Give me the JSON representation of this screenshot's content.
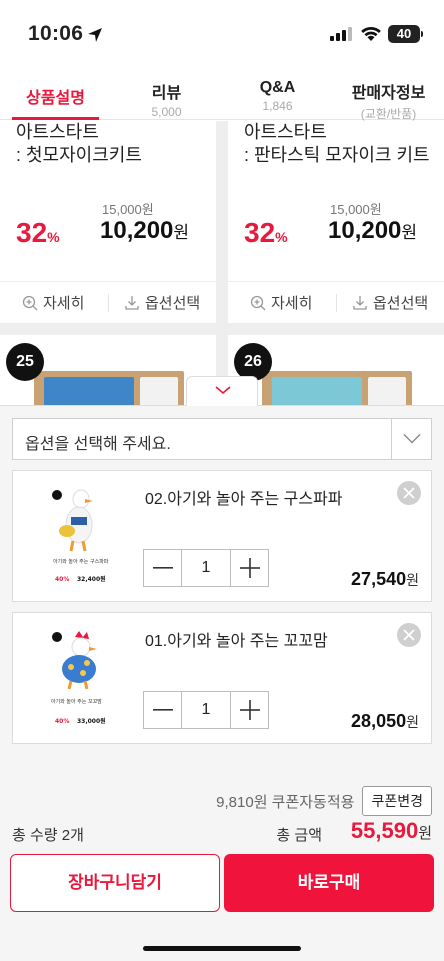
{
  "status": {
    "time": "10:06",
    "battery": "40"
  },
  "tabs": [
    {
      "label": "상품설명",
      "sub": ""
    },
    {
      "label": "리뷰",
      "sub": "5,000"
    },
    {
      "label": "Q&A",
      "sub": "1,846"
    },
    {
      "label": "판매자정보",
      "sub": "(교환/반품)"
    }
  ],
  "products": [
    {
      "name_line1": "아트스타트",
      "name_line2": ": 첫모자이크키트",
      "original_price": "15,000원",
      "discount": "32",
      "discount_unit": "%",
      "price": "10,200",
      "price_unit": "원",
      "detail_label": "자세히",
      "option_label": "옵션선택"
    },
    {
      "name_line1": "아트스타트",
      "name_line2": ": 판타스틱 모자이크 키트",
      "original_price": "15,000원",
      "discount": "32",
      "discount_unit": "%",
      "price": "10,200",
      "price_unit": "원",
      "detail_label": "자세히",
      "option_label": "옵션선택"
    }
  ],
  "next_products": [
    {
      "rank": "25"
    },
    {
      "rank": "26"
    }
  ],
  "option_select": {
    "placeholder": "옵션을 선택해 주세요."
  },
  "selected_options": [
    {
      "title": "02.아기와 놀아 주는 구스파파",
      "quantity": "1",
      "price": "27,540",
      "price_unit": "원",
      "thumb_caption": "아기와 놀아 주는 구스파파",
      "thumb_discount": "40%",
      "thumb_price": "32,400원"
    },
    {
      "title": "01.아기와 놀아 주는 꼬꼬맘",
      "quantity": "1",
      "price": "28,050",
      "price_unit": "원",
      "thumb_caption": "아기와 놀아 주는 꼬꼬맘",
      "thumb_discount": "40%",
      "thumb_price": "33,000원"
    }
  ],
  "coupon": {
    "text": "9,810원 쿠폰자동적용",
    "button": "쿠폰변경"
  },
  "summary": {
    "quantity_label": "총 수량 2개",
    "total_label": "총 금액",
    "total_price": "55,590",
    "total_unit": "원"
  },
  "actions": {
    "cart": "장바구니담기",
    "buy": "바로구매"
  },
  "colors": {
    "accent": "#e8193c",
    "buy_button": "#f0143c",
    "sheet_bg": "#f5f5f5"
  }
}
